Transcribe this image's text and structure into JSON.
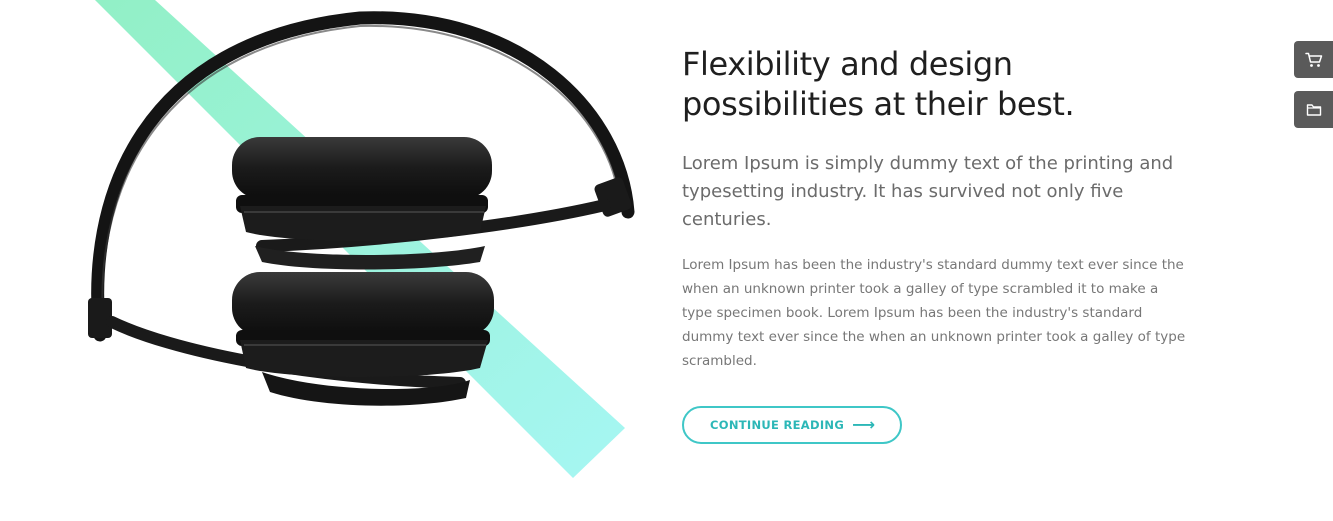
{
  "hero": {
    "image": "black-over-ear-headphones",
    "accent_colors": [
      "#8ff0c8",
      "#9ff4f0"
    ]
  },
  "content": {
    "headline": "Flexibility and design possibilities at their best.",
    "lead": "Lorem Ipsum is simply dummy text of the printing and typesetting industry. It has survived not only five centuries.",
    "body": "Lorem Ipsum has been the industry's standard dummy text ever since the when an unknown printer took a galley of type scrambled it to make a type specimen book. Lorem Ipsum has been the industry's standard dummy text ever since the when an unknown printer took a galley of type scrambled.",
    "cta_label": "CONTINUE READING",
    "cta_icon": "arrow-right-icon",
    "accent_color": "#3fc7c7"
  },
  "side_buttons": [
    {
      "icon": "cart-icon"
    },
    {
      "icon": "folder-icon"
    }
  ]
}
